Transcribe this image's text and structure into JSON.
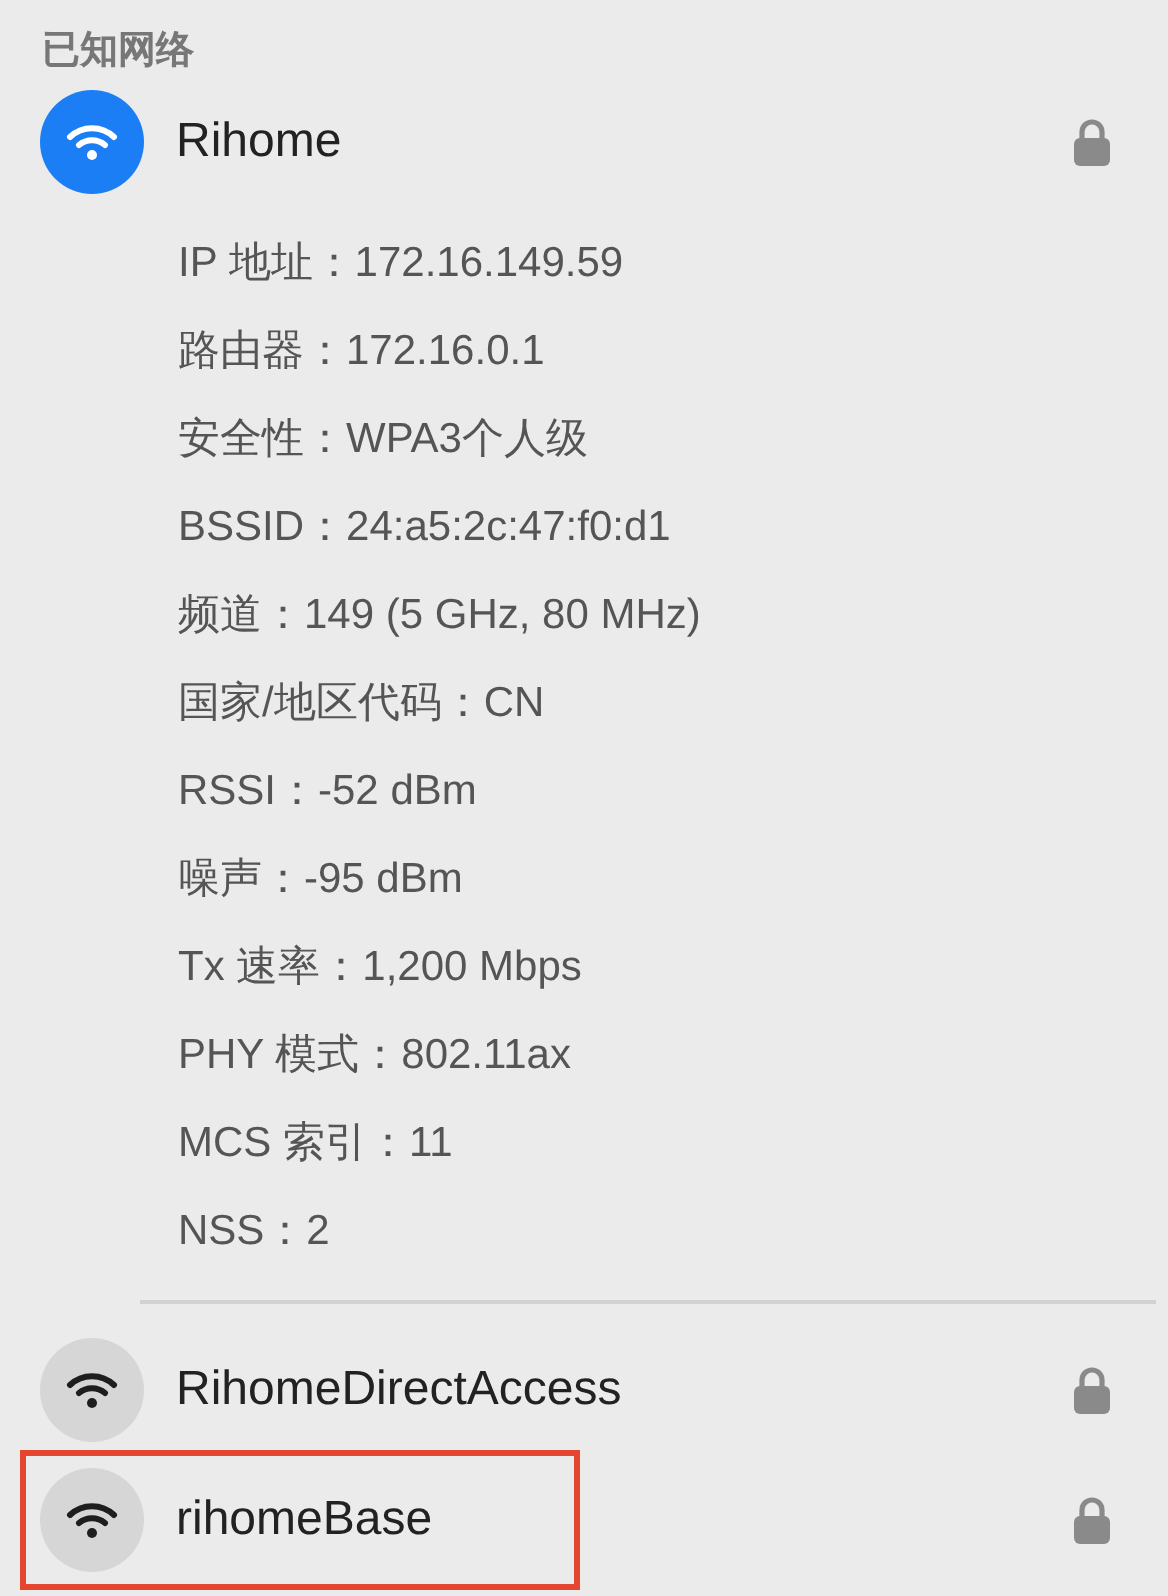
{
  "section_title": "已知网络",
  "networks": [
    {
      "name": "Rihome",
      "connected": true,
      "locked": true,
      "highlighted": false,
      "details": [
        "IP 地址：172.16.149.59",
        "路由器：172.16.0.1",
        "安全性：WPA3个人级",
        "BSSID：24:a5:2c:47:f0:d1",
        "频道：149 (5 GHz, 80 MHz)",
        "国家/地区代码：CN",
        "RSSI：-52 dBm",
        "噪声：-95 dBm",
        "Tx 速率：1,200 Mbps",
        "PHY 模式：802.11ax",
        "MCS 索引：11",
        "NSS：2"
      ]
    },
    {
      "name": "RihomeDirectAccess",
      "connected": false,
      "locked": true,
      "highlighted": false
    },
    {
      "name": "rihomeBase",
      "connected": false,
      "locked": true,
      "highlighted": true
    }
  ]
}
